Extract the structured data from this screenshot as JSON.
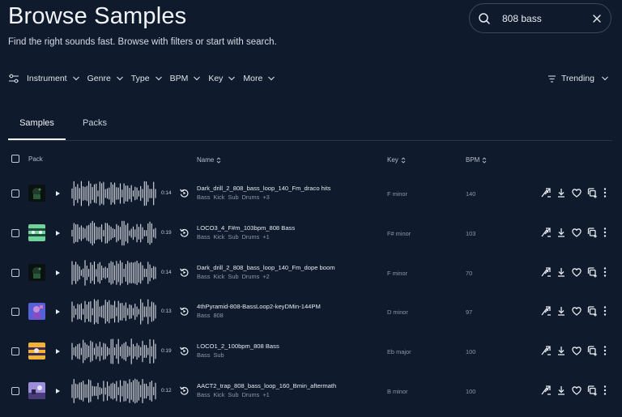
{
  "page": {
    "title": "Browse Samples",
    "subtitle": "Find the right sounds fast. Browse with filters or start with search."
  },
  "search": {
    "value": "808 bass",
    "placeholder": "Search"
  },
  "filters": [
    "Instrument",
    "Genre",
    "Type",
    "BPM",
    "Key",
    "More"
  ],
  "sort": {
    "label": "Trending"
  },
  "tabs": [
    {
      "label": "Samples",
      "active": true
    },
    {
      "label": "Packs",
      "active": false
    }
  ],
  "table": {
    "headers": {
      "pack": "Pack",
      "name": "Name",
      "key": "Key",
      "bpm": "BPM"
    },
    "rows": [
      {
        "cover": "cover-dark-green",
        "duration": "0:14",
        "name": "Dark_drill_2_808_bass_loop_140_Fm_draco hits",
        "tags": [
          "Bass",
          "Kick",
          "Sub",
          "Drums",
          "+3"
        ],
        "key": "F minor",
        "bpm": "140"
      },
      {
        "cover": "cover-green-pattern",
        "duration": "0:19",
        "name": "LOCO3_4_F#m_103bpm_808 Bass",
        "tags": [
          "Bass",
          "Kick",
          "Sub",
          "Drums",
          "+1"
        ],
        "key": "F# minor",
        "bpm": "103"
      },
      {
        "cover": "cover-dark-green",
        "duration": "0:14",
        "name": "Dark_drill_2_808_bass_loop_140_Fm_dope boom",
        "tags": [
          "Bass",
          "Kick",
          "Sub",
          "Drums",
          "+2"
        ],
        "key": "F minor",
        "bpm": "70"
      },
      {
        "cover": "cover-purple-figure",
        "duration": "0:13",
        "name": "4thPyramid-808-BassLoop2-keyDMin-144PM",
        "tags": [
          "Bass",
          "808"
        ],
        "key": "D minor",
        "bpm": "97"
      },
      {
        "cover": "cover-yellow-stripes",
        "duration": "0:19",
        "name": "LOCO1_2_100bpm_808 Bass",
        "tags": [
          "Bass",
          "Sub"
        ],
        "key": "Eb major",
        "bpm": "100"
      },
      {
        "cover": "cover-lavender-scene",
        "duration": "0:12",
        "name": "AACT2_trap_808_bass_loop_160_Bmin_aftermath",
        "tags": [
          "Bass",
          "Kick",
          "Sub",
          "Drums",
          "+1"
        ],
        "key": "B minor",
        "bpm": "100"
      }
    ]
  },
  "colors": {
    "background": "#0f1b2d",
    "text": "#e8ecf2",
    "muted": "#8e98a6"
  },
  "icons": {
    "row_actions": [
      "find-similar-icon",
      "download-icon",
      "heart-icon",
      "add-to-collection-icon",
      "more-icon"
    ]
  }
}
